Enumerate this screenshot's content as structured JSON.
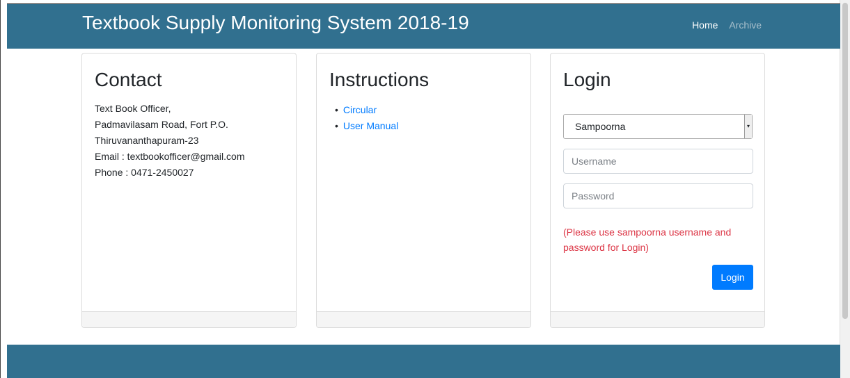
{
  "header": {
    "title": "Textbook Supply Monitoring System 2018-19",
    "nav": {
      "home": "Home",
      "archive": "Archive"
    }
  },
  "contact": {
    "heading": "Contact",
    "lines": [
      "Text Book Officer,",
      "Padmavilasam Road, Fort P.O.",
      "Thiruvananthapuram-23",
      "Email : textbookofficer@gmail.com",
      "Phone : 0471-2450027"
    ]
  },
  "instructions": {
    "heading": "Instructions",
    "links": [
      "Circular",
      "User Manual"
    ]
  },
  "login": {
    "heading": "Login",
    "select_value": "Sampoorna",
    "username_placeholder": "Username",
    "password_placeholder": "Password",
    "note": "(Please use sampoorna username and password for Login)",
    "button": "Login"
  },
  "colors": {
    "navbar": "#31708f",
    "link": "#007bff",
    "note": "#dc3545",
    "button": "#007bff"
  }
}
